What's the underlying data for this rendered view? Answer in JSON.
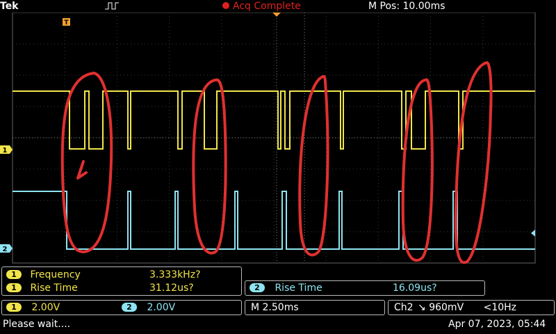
{
  "header": {
    "brand": "Tek",
    "acquisition_status": "Acq Complete",
    "m_pos": "M Pos: 10.00ms",
    "trigger_color": "#f0a030"
  },
  "channels": {
    "ch1": {
      "number": "1",
      "color": "#f2e54a",
      "scale": "2.00V"
    },
    "ch2": {
      "number": "2",
      "color": "#8ee5f2",
      "scale": "2.00V"
    }
  },
  "measurements": {
    "ch1": [
      {
        "channel": "1",
        "label": "Frequency",
        "value": "3.333kHz?"
      },
      {
        "channel": "1",
        "label": "Rise Time",
        "value": "31.12us?"
      }
    ],
    "ch2": [
      {
        "channel": "2",
        "label": "Rise Time",
        "value": "16.09us?"
      }
    ]
  },
  "timebase": "M 2.50ms",
  "trigger_readout": {
    "source": "Ch2",
    "slope": "↘",
    "level": "960mV",
    "filter": "<10Hz"
  },
  "status": {
    "message": "Please wait....",
    "datetime": "Apr 07, 2023, 05:44"
  }
}
